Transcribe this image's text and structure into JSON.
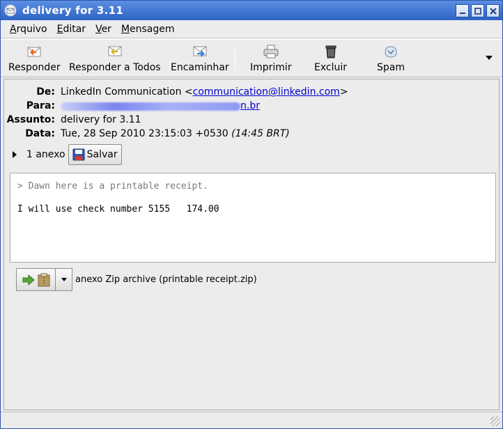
{
  "window": {
    "title": "delivery for 3.11"
  },
  "menu": [
    {
      "label": "Arquivo",
      "accel": "A",
      "rest": "rquivo"
    },
    {
      "label": "Editar",
      "accel": "E",
      "rest": "ditar"
    },
    {
      "label": "Ver",
      "accel": "V",
      "rest": "er"
    },
    {
      "label": "Mensagem",
      "accel": "M",
      "rest": "ensagem"
    }
  ],
  "toolbar": {
    "reply": "Responder",
    "reply_all": "Responder a Todos",
    "forward": "Encaminhar",
    "print": "Imprimir",
    "delete": "Excluir",
    "spam": "Spam"
  },
  "header": {
    "from_label": "De:",
    "from_name": "LinkedIn Communication <",
    "from_email": "communication@linkedin.com",
    "from_close": ">",
    "to_label": "Para:",
    "to_value_tail": "n.br",
    "subject_label": "Assunto:",
    "subject": "delivery for 3.11",
    "date_label": "Data:",
    "date": "Tue, 28 Sep 2010 23:15:03 +0530",
    "date_local": "(14:45 BRT)"
  },
  "attachments": {
    "count_label": "1 anexo",
    "save_label": "Salvar",
    "item_label": "anexo Zip archive (printable receipt.zip)"
  },
  "body": {
    "quote": "> Dawn here is a printable receipt.",
    "line": "I will use check number 5155   174.00"
  }
}
